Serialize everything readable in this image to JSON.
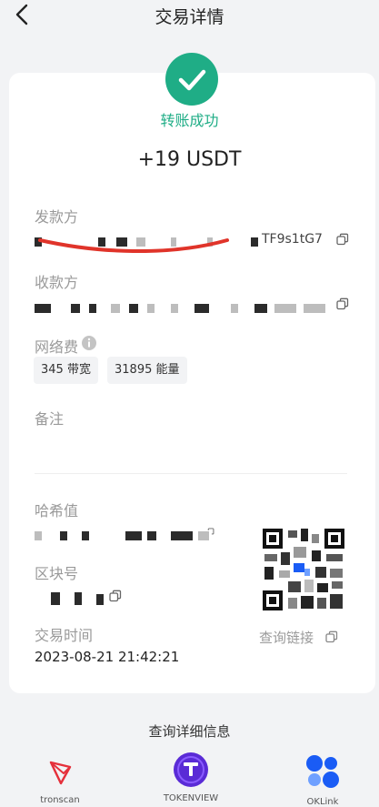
{
  "header": {
    "title": "交易详情"
  },
  "status": {
    "text": "转账成功"
  },
  "amount": "+19 USDT",
  "sender": {
    "label": "发款方",
    "address_tail": "TF9s1tG7"
  },
  "receiver": {
    "label": "收款方"
  },
  "fee": {
    "label": "网络费",
    "bandwidth": "345 带宽",
    "energy": "31895 能量"
  },
  "memo": {
    "label": "备注",
    "value": ""
  },
  "hash": {
    "label": "哈希值"
  },
  "block": {
    "label": "区块号"
  },
  "time": {
    "label": "交易时间",
    "value": "2023-08-21 21:42:21"
  },
  "query_link": "查询链接",
  "detail_title": "查询详细信息",
  "explorers": [
    {
      "name": "tronscan",
      "icon": "tronscan-icon"
    },
    {
      "name": "TOKENVIEW",
      "icon": "tokenview-icon"
    },
    {
      "name": "OKLink",
      "icon": "oklink-icon"
    }
  ],
  "colors": {
    "success": "#1fad86",
    "background": "#f2f3f5",
    "card": "#ffffff",
    "tron_red": "#e5303b",
    "oklink_blue": "#1a5cf5"
  }
}
